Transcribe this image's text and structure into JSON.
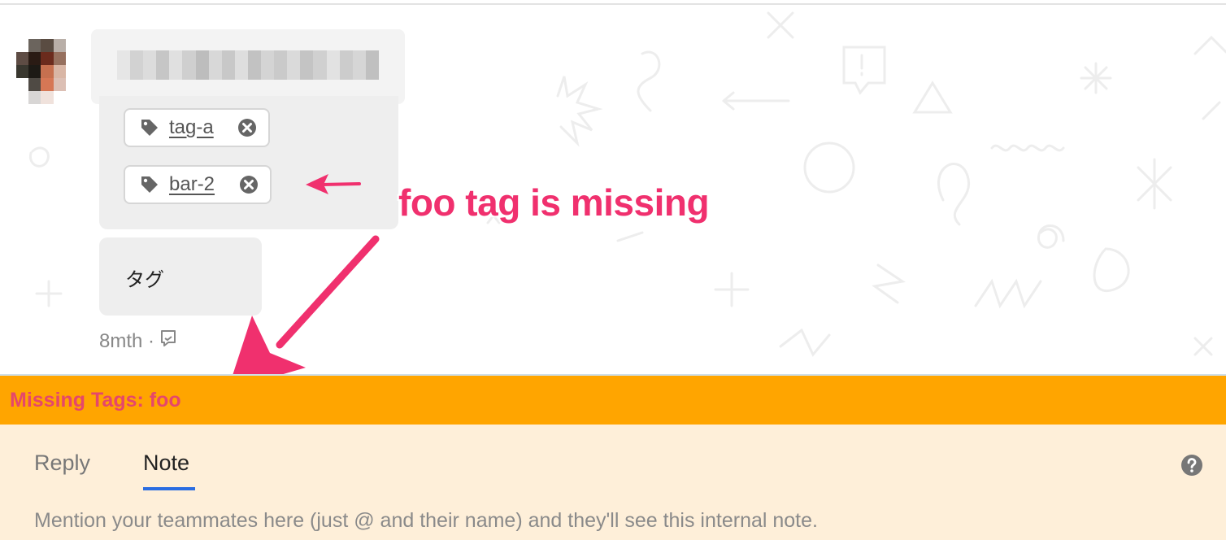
{
  "conversation": {
    "tags": [
      {
        "label": "tag-a",
        "icon": "tag-icon",
        "remove_icon": "remove-tag-icon"
      },
      {
        "label": "bar-2",
        "icon": "tag-icon",
        "remove_icon": "remove-tag-icon"
      }
    ],
    "message_text": "タグ",
    "meta_time": "8mth ·",
    "meta_icon": "note-icon"
  },
  "annotation": {
    "text": "foo tag is missing",
    "color": "#f0306e"
  },
  "banner": {
    "text": "Missing Tags: foo",
    "background": "#ffa500",
    "text_color": "#e5476b"
  },
  "composer": {
    "tabs": [
      {
        "label": "Reply",
        "active": false
      },
      {
        "label": "Note",
        "active": true
      }
    ],
    "placeholder": "Mention your teammates here (just @ and their name) and they'll see this internal note.",
    "background": "#feefd9",
    "accent": "#2a6de1",
    "help_icon": "help-icon"
  }
}
